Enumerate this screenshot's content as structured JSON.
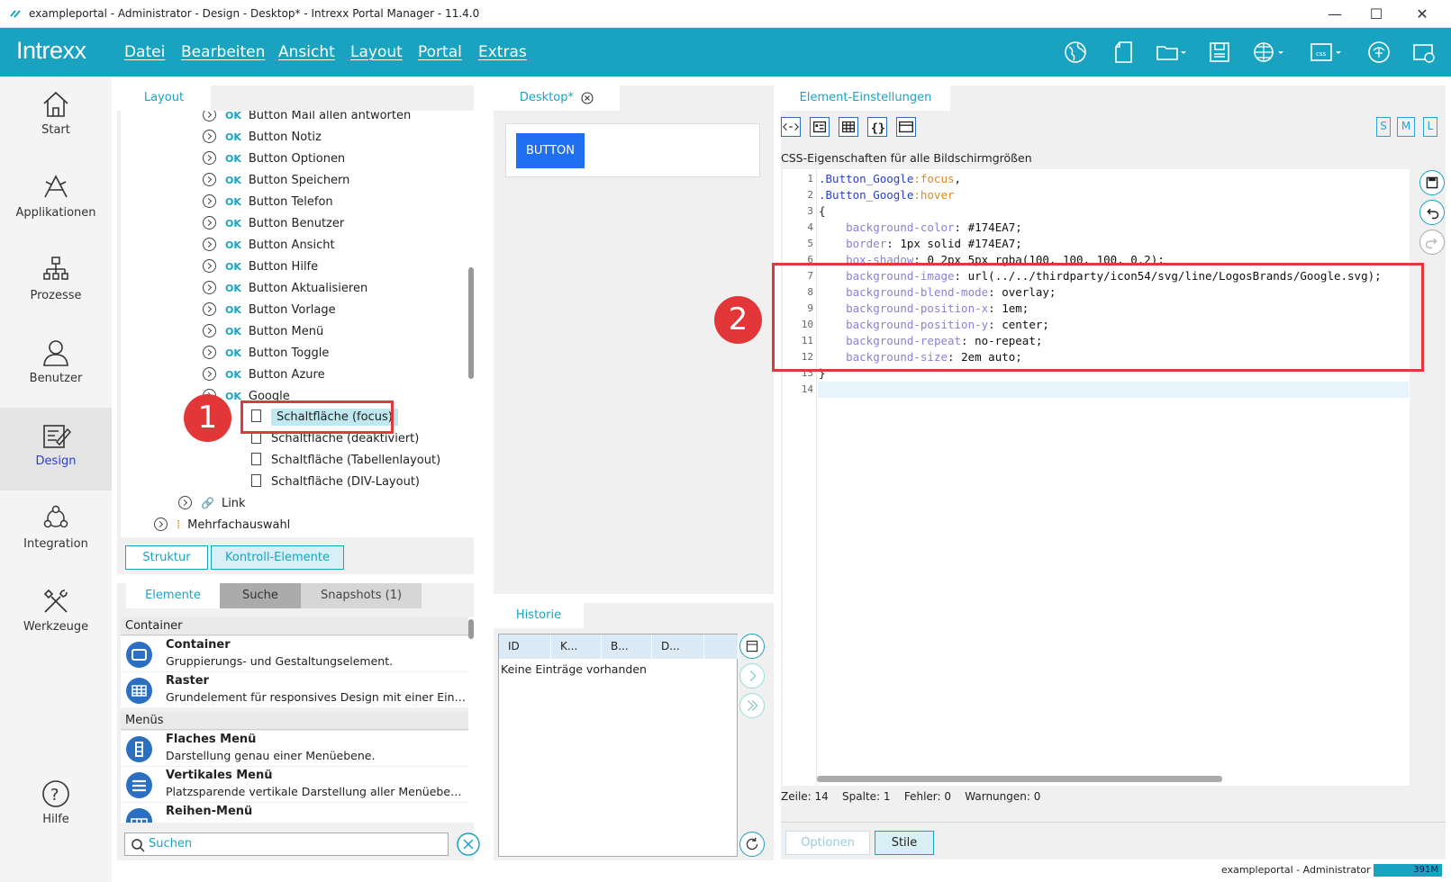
{
  "window": {
    "title": "exampleportal - Administrator - Design - Desktop* - Intrexx Portal Manager - 11.4.0",
    "min": "—",
    "max": "☐",
    "close": "✕"
  },
  "topbar": {
    "brand": "Intrexx",
    "menus": [
      "Datei",
      "Bearbeiten",
      "Ansicht",
      "Layout",
      "Portal",
      "Extras"
    ]
  },
  "nav": [
    {
      "label": "Start",
      "icon": "home-icon"
    },
    {
      "label": "Applikationen",
      "icon": "applications-icon"
    },
    {
      "label": "Prozesse",
      "icon": "processes-icon"
    },
    {
      "label": "Benutzer",
      "icon": "user-icon"
    },
    {
      "label": "Design",
      "icon": "design-icon",
      "selected": true
    },
    {
      "label": "Integration",
      "icon": "integration-icon"
    },
    {
      "label": "Werkzeuge",
      "icon": "tools-icon"
    },
    {
      "label": "Hilfe",
      "icon": "help-icon"
    }
  ],
  "layout_tab": "Layout",
  "tree": {
    "ok_rows": [
      "Button Mail allen antworten",
      "Button Notiz",
      "Button Optionen",
      "Button Speichern",
      "Button Telefon",
      "Button Benutzer",
      "Button Ansicht",
      "Button Hilfe",
      "Button Aktualisieren",
      "Button Vorlage",
      "Button Menü",
      "Button Toggle",
      "Button Azure",
      "Google"
    ],
    "ok_label": "OK",
    "selected_child": "Schaltfläche (focus)",
    "children": [
      "Schaltfläche (deaktiviert)",
      "Schaltfläche (Tabellenlayout)",
      "Schaltfläche (DIV-Layout)"
    ],
    "link": "Link",
    "multi": "Mehrfachauswahl"
  },
  "structure_buttons": [
    "Struktur",
    "Kontroll-Elemente"
  ],
  "elements_tabs": [
    "Elemente",
    "Suche",
    "Snapshots (1)"
  ],
  "element_groups": [
    {
      "group": "Container",
      "items": [
        {
          "name": "Container",
          "desc": "Gruppierungs- und Gestaltungselement."
        },
        {
          "name": "Raster",
          "desc": "Grundelement für responsives Design mit einer Einteil..."
        }
      ]
    },
    {
      "group": "Menüs",
      "items": [
        {
          "name": "Flaches Menü",
          "desc": "Darstellung genau einer Menüebene."
        },
        {
          "name": "Vertikales Menü",
          "desc": "Platzsparende vertikale Darstellung aller Menüebenen..."
        },
        {
          "name": "Reihen-Menü",
          "desc": ""
        }
      ]
    }
  ],
  "search": {
    "placeholder": "Suchen"
  },
  "desktop": {
    "tab": "Desktop*",
    "button": "BUTTON"
  },
  "history": {
    "tab": "Historie",
    "columns": [
      "ID",
      "K...",
      "B...",
      "D..."
    ],
    "empty": "Keine Einträge vorhanden"
  },
  "settings": {
    "tab": "Element-Einstellungen",
    "css_title": "CSS-Eigenschaften für alle Bildschirmgrößen",
    "sizes": [
      "S",
      "M",
      "L"
    ],
    "status": {
      "line": "Zeile: 14",
      "col": "Spalte: 1",
      "errors": "Fehler: 0",
      "warnings": "Warnungen: 0"
    },
    "buttons": [
      "Optionen",
      "Stile"
    ]
  },
  "code_lines": [
    {
      "n": "1",
      "sel": ".Button_Google",
      "pse": ":focus",
      "tail": ","
    },
    {
      "n": "2",
      "sel": ".Button_Google",
      "pse": ":hover",
      "tail": ""
    },
    {
      "n": "3",
      "plain": "{"
    },
    {
      "n": "4",
      "prop": "background-color",
      "val": "#174EA7;"
    },
    {
      "n": "5",
      "prop": "border",
      "val": "1px solid #174EA7;"
    },
    {
      "n": "6",
      "prop": "box-shadow",
      "val": "0 2px 5px rgba(100, 100, 100, 0.2);"
    },
    {
      "n": "7",
      "prop": "background-image",
      "val": "url(../../thirdparty/icon54/svg/line/LogosBrands/Google.svg);"
    },
    {
      "n": "8",
      "prop": "background-blend-mode",
      "val": "overlay;"
    },
    {
      "n": "9",
      "prop": "background-position-x",
      "val": "1em;"
    },
    {
      "n": "10",
      "prop": "background-position-y",
      "val": "center;"
    },
    {
      "n": "11",
      "prop": "background-repeat",
      "val": "no-repeat;"
    },
    {
      "n": "12",
      "prop": "background-size",
      "val": "2em auto;"
    },
    {
      "n": "13",
      "plain": "}"
    },
    {
      "n": "14",
      "plain": ""
    }
  ],
  "badges": [
    "1",
    "2"
  ],
  "footer": {
    "text": "exampleportal - Administrator",
    "memory": "391M"
  }
}
